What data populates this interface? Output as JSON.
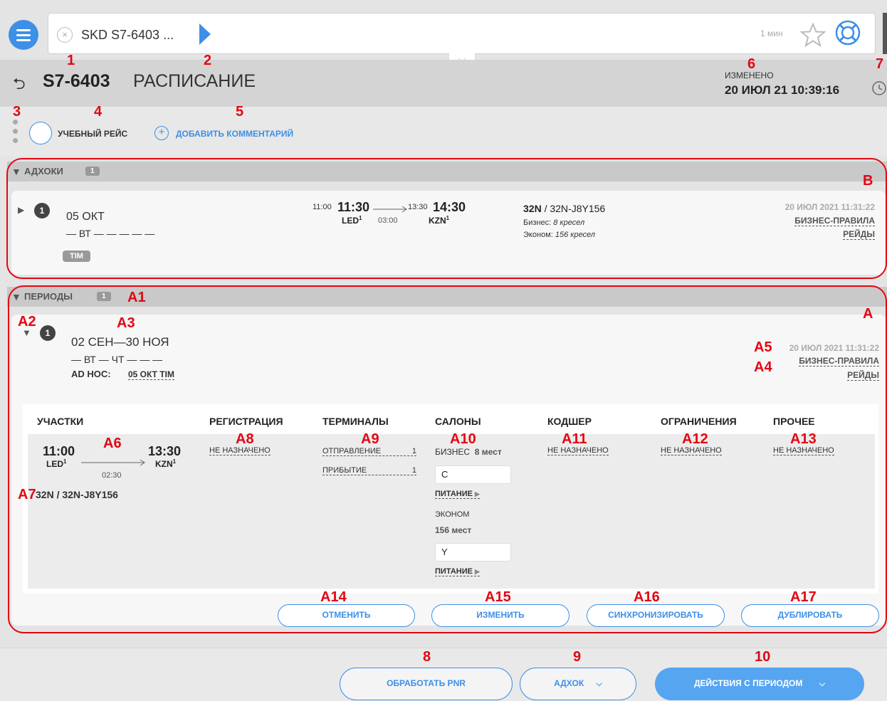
{
  "header": {
    "tab_label": "SKD S7-6403 ...",
    "time_ago": "1 мин",
    "flight": "S7-6403",
    "page_title": "РАСПИСАНИЕ",
    "changed_label": "ИЗМЕНЕНО",
    "changed_value": "20 ИЮЛ 21 10:39:16"
  },
  "toolbar": {
    "training_label": "УЧЕБНЫЙ РЕЙС",
    "add_comment": "ДОБАВИТЬ КОММЕНТАРИЙ"
  },
  "markers": {
    "m1": "1",
    "m2": "2",
    "m3": "3",
    "m4": "4",
    "m5": "5",
    "m6": "6",
    "m7": "7",
    "m8": "8",
    "m9": "9",
    "m10": "10",
    "B": "B",
    "A": "A",
    "A1": "A1",
    "A2": "A2",
    "A3": "A3",
    "A4": "A4",
    "A5": "A5",
    "A6": "A6",
    "A7": "A7",
    "A8": "A8",
    "A9": "A9",
    "A10": "A10",
    "A11": "A11",
    "A12": "A12",
    "A13": "A13",
    "A14": "A14",
    "A15": "A15",
    "A16": "A16",
    "A17": "A17"
  },
  "adhoc": {
    "title": "АДХОКИ",
    "count": "1",
    "item_num": "1",
    "date": "05 ОКТ",
    "days": "— ВТ — — — — —",
    "tag": "TIM",
    "dep_small": "11:00",
    "dep_time": "11:30",
    "dep_airport": "LED",
    "dep_sup": "1",
    "duration": "03:00",
    "arr_small": "13:30",
    "arr_time": "14:30",
    "arr_airport": "KZN",
    "arr_sup": "1",
    "aircraft_bold": "32N",
    "aircraft_rest": " / 32N-J8Y156",
    "business_label": "Бизнес:",
    "business_seats": "8 кресел",
    "economy_label": "Эконом:",
    "economy_seats": "156 кресел",
    "timestamp": "20 ИЮЛ 2021 11:31:22",
    "link1": "БИЗНЕС-ПРАВИЛА",
    "link2": "РЕЙДЫ"
  },
  "periods": {
    "title": "ПЕРИОДЫ",
    "count": "1",
    "item_num": "1",
    "range": "02 СЕН—30 НОЯ",
    "days": "— ВТ — ЧТ — — —",
    "adhoc_label": "AD HOC:",
    "adhoc_value": "05 ОКТ TIM",
    "timestamp": "20 ИЮЛ 2021 11:31:22",
    "link1": "БИЗНЕС-ПРАВИЛА",
    "link2": "РЕЙДЫ"
  },
  "columns": {
    "segments": "УЧАСТКИ",
    "registration": "РЕГИСТРАЦИЯ",
    "terminals": "ТЕРМИНАЛЫ",
    "cabins": "САЛОНЫ",
    "codeshare": "КОДШЕР",
    "restrictions": "ОГРАНИЧЕНИЯ",
    "other": "ПРОЧЕЕ"
  },
  "segment": {
    "dep_time": "11:00",
    "dep_airport": "LED",
    "dep_sup": "1",
    "duration": "02:30",
    "arr_time": "13:30",
    "arr_airport": "KZN",
    "arr_sup": "1",
    "aircraft": "32N / 32N-J8Y156",
    "not_assigned": "НЕ НАЗНАЧЕНО",
    "departure_label": "ОТПРАВЛЕНИЕ",
    "departure_val": "1",
    "arrival_label": "ПРИБЫТИЕ",
    "arrival_val": "1",
    "business_label": "БИЗНЕС",
    "business_seats": "8 мест",
    "business_class": "C",
    "meal": "ПИТАНИЕ",
    "economy_label": "ЭКОНОМ",
    "economy_seats": "156 мест",
    "economy_class": "Y"
  },
  "actions": {
    "cancel": "ОТМЕНИТЬ",
    "modify": "ИЗМЕНИТЬ",
    "sync": "СИНХРОНИЗИРОВАТЬ",
    "duplicate": "ДУБЛИРОВАТЬ"
  },
  "footer": {
    "process_pnr": "ОБРАБОТАТЬ PNR",
    "adhoc": "АДХОК",
    "period_actions": "ДЕЙСТВИЯ С ПЕРИОДОМ"
  },
  "colors": {
    "accent": "#3d8fe8",
    "marker": "#e30613"
  }
}
